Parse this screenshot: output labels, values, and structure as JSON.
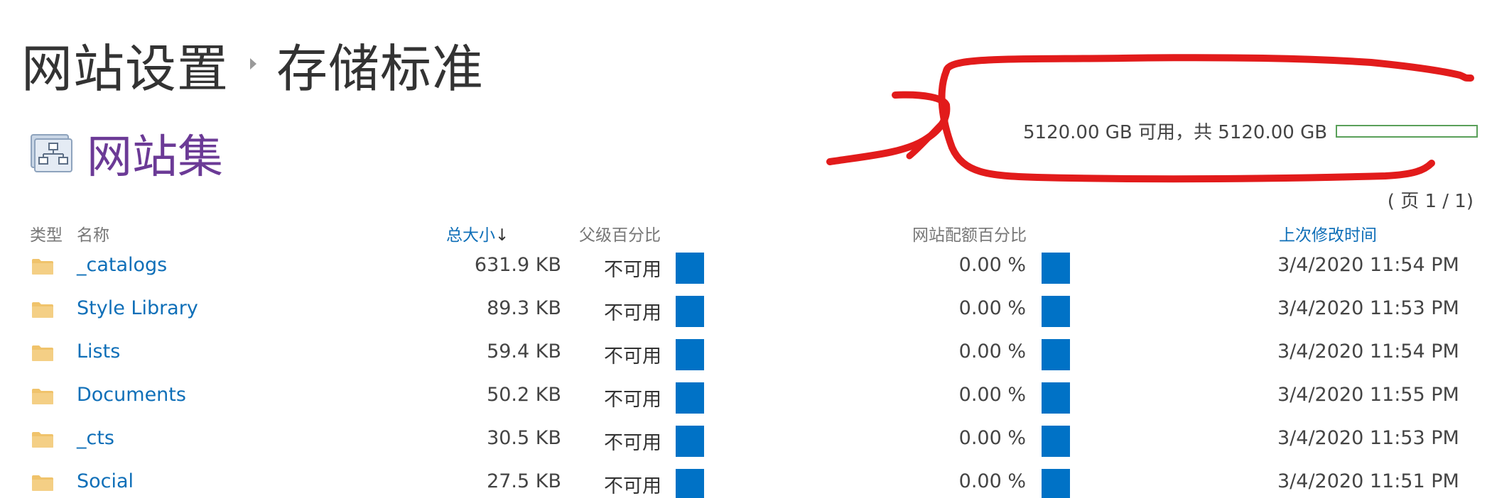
{
  "breadcrumb": {
    "parent": "网站设置",
    "current": "存储标准"
  },
  "site_collection": {
    "title": "网站集",
    "icon": "site-hierarchy-icon"
  },
  "quota": {
    "summary": "5120.00 GB 可用，共 5120.00 GB",
    "used_fraction": 0.0,
    "bar_color": "#5aa05a"
  },
  "pager": {
    "label": "( 页 1 / 1)"
  },
  "table": {
    "headers": {
      "type": "类型",
      "name": "名称",
      "total_size": "总大小",
      "sort_indicator": "↓",
      "parent_percent": "父级百分比",
      "quota_percent": "网站配额百分比",
      "last_modified": "上次修改时间"
    },
    "rows": [
      {
        "type_icon": "folder-icon",
        "name": "_catalogs",
        "size": "631.9 KB",
        "parent_percent": "不可用",
        "quota_percent": "0.00 %",
        "modified": "3/4/2020 11:54 PM"
      },
      {
        "type_icon": "folder-icon",
        "name": "Style Library",
        "size": "89.3 KB",
        "parent_percent": "不可用",
        "quota_percent": "0.00 %",
        "modified": "3/4/2020 11:53 PM"
      },
      {
        "type_icon": "folder-icon",
        "name": "Lists",
        "size": "59.4 KB",
        "parent_percent": "不可用",
        "quota_percent": "0.00 %",
        "modified": "3/4/2020 11:54 PM"
      },
      {
        "type_icon": "folder-icon",
        "name": "Documents",
        "size": "50.2 KB",
        "parent_percent": "不可用",
        "quota_percent": "0.00 %",
        "modified": "3/4/2020 11:55 PM"
      },
      {
        "type_icon": "folder-icon",
        "name": "_cts",
        "size": "30.5 KB",
        "parent_percent": "不可用",
        "quota_percent": "0.00 %",
        "modified": "3/4/2020 11:53 PM"
      },
      {
        "type_icon": "folder-icon",
        "name": "Social",
        "size": "27.5 KB",
        "parent_percent": "不可用",
        "quota_percent": "0.00 %",
        "modified": "3/4/2020 11:51 PM"
      }
    ]
  },
  "colors": {
    "link": "#0f6fb8",
    "title_purple": "#6b3a96",
    "usage_bar": "#0072c6",
    "annotation_red": "#e21b1b",
    "folder": "#f0c36b"
  }
}
